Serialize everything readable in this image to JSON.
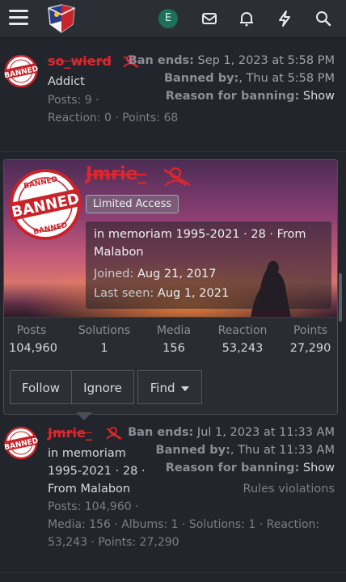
{
  "nav": {
    "avatar_letter": "E",
    "icons": [
      "menu-icon",
      "envelope-icon",
      "bell-icon",
      "bolt-icon",
      "search-icon"
    ]
  },
  "stamp": {
    "word": "BANNED"
  },
  "post1": {
    "username": "so_wierd",
    "user_title": "Addict",
    "posts": "Posts: 9 ·",
    "reaction_points": "Reaction: 0 · Points: 68",
    "ban_ends_label": "Ban ends:",
    "ban_ends_value": "Sep 1, 2023 at 5:58 PM",
    "banned_by_label": "Banned by:",
    "banned_by_value": ", Thu at 5:58 PM",
    "reason_label": "Reason for banning:",
    "reason_value": "Show"
  },
  "card": {
    "username": "Jmrie_",
    "badge": "Limited Access",
    "about_line1": "in memoriam 1995-2021 · 28 · From",
    "about_line2": "Malabon",
    "joined_label": "Joined:",
    "joined_value": "Aug 21, 2017",
    "last_seen_label": "Last seen:",
    "last_seen_value": "Aug 1, 2021",
    "stats": [
      {
        "label": "Posts",
        "value": "104,960"
      },
      {
        "label": "Solutions",
        "value": "1"
      },
      {
        "label": "Media",
        "value": "156"
      },
      {
        "label": "Reaction",
        "value": "53,243"
      },
      {
        "label": "Points",
        "value": "27,290"
      }
    ],
    "follow_label": "Follow",
    "ignore_label": "Ignore",
    "find_label": "Find"
  },
  "post2": {
    "username": "Jmrie_",
    "title_line1": "in memoriam",
    "title_line2": "1995-2021 · 28 ·",
    "title_line3": "From Malabon",
    "posts": "Posts: 104,960 ·",
    "media_line": "Media: 156 · Albums: 1 · Solutions: 1 · Reaction:",
    "media_line2": "53,243 · Points: 27,290",
    "ban_ends_label": "Ban ends:",
    "ban_ends_value": "Jul 1, 2023 at 11:33 AM",
    "banned_by_label": "Banned by:",
    "banned_by_value": ", Thu at 11:33 AM",
    "reason_label": "Reason for banning:",
    "reason_value": "Show",
    "reason_text": "Rules violations"
  },
  "colors": {
    "accent_red": "#e0262d",
    "background": "#22252b",
    "avatar_bg": "#1f6f5f"
  }
}
